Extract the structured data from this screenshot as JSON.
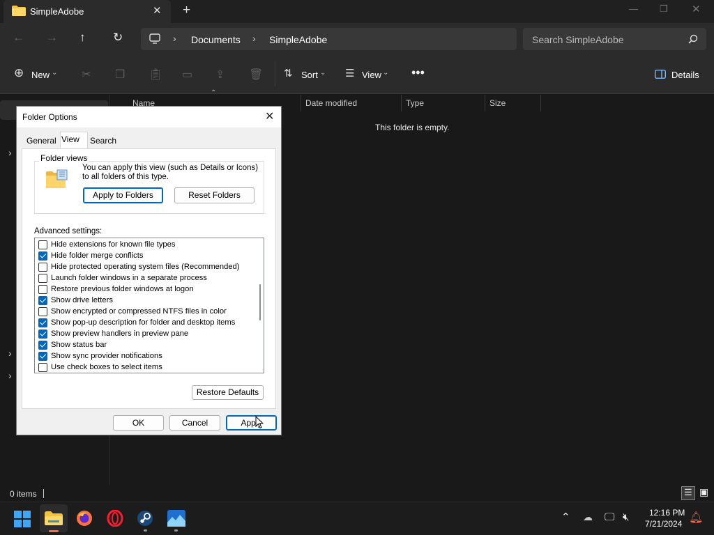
{
  "window": {
    "tab_title": "SimpleAdobe"
  },
  "address": {
    "crumbs": [
      "Documents",
      "SimpleAdobe"
    ],
    "search_placeholder": "Search SimpleAdobe"
  },
  "toolbar": {
    "new_label": "New",
    "sort_label": "Sort",
    "view_label": "View",
    "details_label": "Details"
  },
  "columns": [
    "Name",
    "Date modified",
    "Type",
    "Size"
  ],
  "main": {
    "empty_message": "This folder is empty."
  },
  "status": {
    "item_count": "0 items"
  },
  "taskbar": {
    "time": "12:16 PM",
    "date": "7/21/2024",
    "accent": "#0067c0"
  },
  "dialog": {
    "title": "Folder Options",
    "tabs": [
      "General",
      "View",
      "Search"
    ],
    "active_tab": "View",
    "folder_views_label": "Folder views",
    "folder_views_text": "You can apply this view (such as Details or Icons) to all folders of this type.",
    "apply_to_folders": "Apply to Folders",
    "reset_folders": "Reset Folders",
    "advanced_label": "Advanced settings:",
    "advanced_items": [
      {
        "label": "Hide extensions for known file types",
        "checked": false
      },
      {
        "label": "Hide folder merge conflicts",
        "checked": true
      },
      {
        "label": "Hide protected operating system files (Recommended)",
        "checked": false
      },
      {
        "label": "Launch folder windows in a separate process",
        "checked": false
      },
      {
        "label": "Restore previous folder windows at logon",
        "checked": false
      },
      {
        "label": "Show drive letters",
        "checked": true
      },
      {
        "label": "Show encrypted or compressed NTFS files in color",
        "checked": false
      },
      {
        "label": "Show pop-up description for folder and desktop items",
        "checked": true
      },
      {
        "label": "Show preview handlers in preview pane",
        "checked": true
      },
      {
        "label": "Show status bar",
        "checked": true
      },
      {
        "label": "Show sync provider notifications",
        "checked": true
      },
      {
        "label": "Use check boxes to select items",
        "checked": false
      }
    ],
    "restore_defaults": "Restore Defaults",
    "ok": "OK",
    "cancel": "Cancel",
    "apply": "Apply"
  }
}
